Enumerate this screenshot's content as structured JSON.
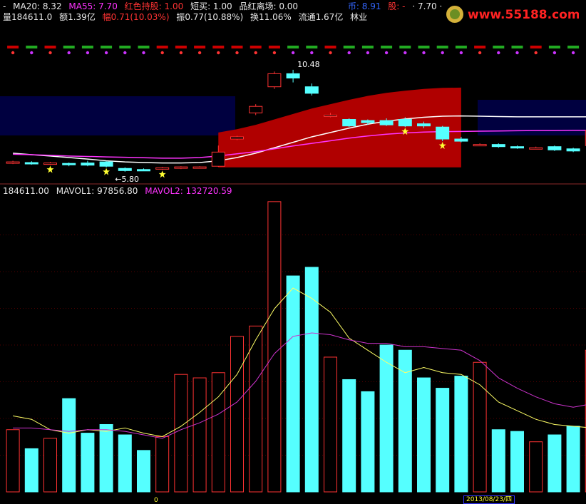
{
  "header": {
    "line1": {
      "dash": "-",
      "ma20_label": "MA20: 8.32",
      "ma55_label": "MA55: 7.70",
      "red_hold_label": "红色持股: 1.00",
      "short_buy_label": "短买: 1.00",
      "leave_label": "品红离场: 0.00",
      "currency_label": "币: 8.91",
      "stock_label": "股: -",
      "price_label": "·  7.70  ·"
    },
    "line2": {
      "volume": "量184611.0",
      "amount": "额1.39亿",
      "change": "幅0.71(10.03%)",
      "amplitude": "振0.77(10.88%)",
      "turnover": "换11.06%",
      "float": "流通1.67亿",
      "sector": "林业"
    },
    "vol_line": {
      "vol": "184611.00",
      "mavol1": "MAVOL1: 97856.80",
      "mavol2": "MAVOL2: 132720.59"
    }
  },
  "logo": {
    "text": "www.55188.com"
  },
  "date_label": "2013/08/23/四",
  "zero_label": "0",
  "colors": {
    "up": "#ff3333",
    "down": "#55ffff",
    "ma_white": "#ffffff",
    "ma_pink": "#ff33ff",
    "mavol1": "#ffff66",
    "mavol2": "#cc33cc",
    "band_blue": "#000040",
    "grid": "#550000"
  },
  "chart_data": [
    {
      "type": "candlestick",
      "annotations": [
        {
          "text": "10.48",
          "kind": "high",
          "index": 15
        },
        {
          "text": "←5.80",
          "kind": "low",
          "index": 6
        }
      ],
      "x": [
        1,
        2,
        3,
        4,
        5,
        6,
        7,
        8,
        9,
        10,
        11,
        12,
        13,
        14,
        15,
        16,
        17,
        18,
        19,
        20,
        21,
        22,
        23,
        24,
        25,
        26,
        27,
        28,
        29,
        30,
        31,
        32
      ],
      "candles": [
        {
          "o": 6.2,
          "c": 6.25,
          "h": 6.3,
          "l": 6.15
        },
        {
          "o": 6.22,
          "c": 6.18,
          "h": 6.28,
          "l": 6.12
        },
        {
          "o": 6.15,
          "c": 6.2,
          "h": 6.25,
          "l": 6.1
        },
        {
          "o": 6.18,
          "c": 6.12,
          "h": 6.22,
          "l": 6.05
        },
        {
          "o": 6.2,
          "c": 6.1,
          "h": 6.3,
          "l": 6.05
        },
        {
          "o": 6.25,
          "c": 6.05,
          "h": 6.28,
          "l": 6.0
        },
        {
          "o": 5.95,
          "c": 5.85,
          "h": 6.0,
          "l": 5.8
        },
        {
          "o": 5.9,
          "c": 5.88,
          "h": 5.95,
          "l": 5.84
        },
        {
          "o": 5.92,
          "c": 5.98,
          "h": 6.02,
          "l": 5.88
        },
        {
          "o": 5.98,
          "c": 6.02,
          "h": 6.05,
          "l": 5.92
        },
        {
          "o": 5.98,
          "c": 6.02,
          "h": 6.05,
          "l": 5.95
        },
        {
          "o": 6.05,
          "c": 6.7,
          "h": 7.0,
          "l": 6.02
        },
        {
          "o": 7.3,
          "c": 7.4,
          "h": 7.45,
          "l": 7.25
        },
        {
          "o": 8.5,
          "c": 8.8,
          "h": 8.9,
          "l": 8.4
        },
        {
          "o": 9.7,
          "c": 10.3,
          "h": 10.4,
          "l": 9.6
        },
        {
          "o": 10.3,
          "c": 10.1,
          "h": 10.48,
          "l": 9.9
        },
        {
          "o": 9.7,
          "c": 9.4,
          "h": 9.85,
          "l": 9.3
        },
        {
          "o": 8.4,
          "c": 8.4,
          "h": 8.5,
          "l": 8.3
        },
        {
          "o": 8.2,
          "c": 7.9,
          "h": 8.25,
          "l": 7.85
        },
        {
          "o": 8.15,
          "c": 8.05,
          "h": 8.2,
          "l": 7.95
        },
        {
          "o": 8.15,
          "c": 7.95,
          "h": 8.25,
          "l": 7.9
        },
        {
          "o": 8.2,
          "c": 7.9,
          "h": 8.3,
          "l": 7.85
        },
        {
          "o": 8.0,
          "c": 7.9,
          "h": 8.1,
          "l": 7.8
        },
        {
          "o": 7.85,
          "c": 7.3,
          "h": 7.9,
          "l": 7.2
        },
        {
          "o": 7.3,
          "c": 7.2,
          "h": 7.4,
          "l": 7.15
        },
        {
          "o": 7.05,
          "c": 7.05,
          "h": 7.1,
          "l": 7.0
        },
        {
          "o": 7.05,
          "c": 6.95,
          "h": 7.1,
          "l": 6.9
        },
        {
          "o": 6.95,
          "c": 6.9,
          "h": 7.0,
          "l": 6.85
        },
        {
          "o": 6.9,
          "c": 6.9,
          "h": 6.95,
          "l": 6.85
        },
        {
          "o": 6.95,
          "c": 6.8,
          "h": 7.0,
          "l": 6.75
        },
        {
          "o": 6.85,
          "c": 6.75,
          "h": 6.9,
          "l": 6.7
        },
        {
          "o": 7.0,
          "c": 7.7,
          "h": 7.75,
          "l": 6.9
        }
      ],
      "series": [
        {
          "name": "MA20",
          "values": [
            6.65,
            6.58,
            6.52,
            6.45,
            6.38,
            6.3,
            6.25,
            6.22,
            6.2,
            6.2,
            6.22,
            6.3,
            6.45,
            6.65,
            6.9,
            7.15,
            7.4,
            7.6,
            7.8,
            7.98,
            8.12,
            8.22,
            8.3,
            8.35,
            8.36,
            8.35,
            8.33,
            8.32,
            8.32,
            8.32,
            8.32,
            8.32
          ]
        },
        {
          "name": "MA55",
          "values": [
            6.6,
            6.58,
            6.55,
            6.52,
            6.5,
            6.48,
            6.46,
            6.44,
            6.42,
            6.42,
            6.45,
            6.52,
            6.62,
            6.72,
            6.85,
            6.98,
            7.1,
            7.22,
            7.34,
            7.44,
            7.52,
            7.58,
            7.62,
            7.64,
            7.65,
            7.66,
            7.67,
            7.68,
            7.69,
            7.69,
            7.7,
            7.7
          ]
        }
      ],
      "ylim": [
        5.5,
        11.0
      ]
    },
    {
      "type": "bar",
      "x": [
        1,
        2,
        3,
        4,
        5,
        6,
        7,
        8,
        9,
        10,
        11,
        12,
        13,
        14,
        15,
        16,
        17,
        18,
        19,
        20,
        21,
        22,
        23,
        24,
        25,
        26,
        27,
        28,
        29,
        30,
        31,
        32
      ],
      "values": [
        36000,
        25000,
        31000,
        54000,
        34000,
        39000,
        33000,
        24000,
        32000,
        68000,
        66000,
        69000,
        90000,
        96000,
        168000,
        125000,
        130000,
        78000,
        65000,
        58000,
        85000,
        82000,
        66000,
        60000,
        67000,
        75000,
        36000,
        35000,
        29000,
        33000,
        38000,
        82000
      ],
      "series": [
        {
          "name": "MAVOL1",
          "values": [
            44000,
            42000,
            36000,
            34000,
            36000,
            35000,
            37000,
            34000,
            32000,
            38000,
            46000,
            55000,
            68000,
            88000,
            106000,
            118000,
            112000,
            104000,
            89000,
            82000,
            75000,
            69000,
            72000,
            69000,
            68000,
            62000,
            52000,
            47000,
            42000,
            39000,
            38000,
            37000
          ]
        },
        {
          "name": "MAVOL2",
          "values": [
            37000,
            37000,
            36000,
            35000,
            36000,
            36000,
            35000,
            33000,
            31000,
            36000,
            40000,
            45000,
            52000,
            64000,
            80000,
            90000,
            92000,
            91000,
            88000,
            86000,
            86000,
            84000,
            84000,
            83000,
            82000,
            76000,
            66000,
            60000,
            55000,
            51000,
            49000,
            51000
          ]
        }
      ],
      "ylim": [
        0,
        170000
      ]
    }
  ]
}
